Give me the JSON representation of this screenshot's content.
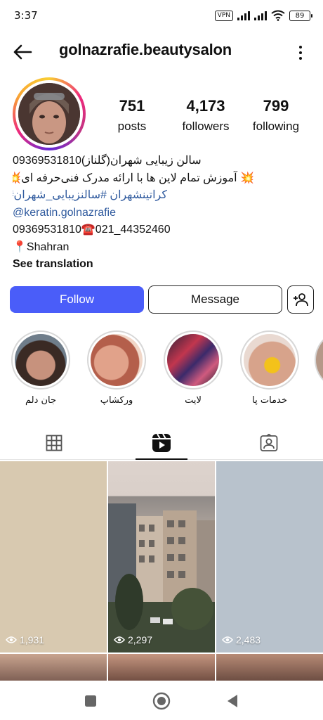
{
  "status": {
    "time": "3:37",
    "vpn": "VPN",
    "battery": "89"
  },
  "header": {
    "username": "golnazrafie.beautysalon"
  },
  "stats": {
    "posts_count": "751",
    "posts_label": "posts",
    "followers_count": "4,173",
    "followers_label": "followers",
    "following_count": "799",
    "following_label": "following"
  },
  "bio": {
    "line1": "سالن زیبایی شهران(گلناز)09369531810",
    "line2": "💥 آموزش تمام لاین ها با ارائه مدرک فنی‌حرفه ای💥",
    "line3": "کراتینشهران #سالنزیبایی_شهران#",
    "line4": "@keratin.golnazrafie",
    "line5": "09369531810☎️021_44352460",
    "line6": "📍Shahran",
    "see_translation": "See translation"
  },
  "actions": {
    "follow": "Follow",
    "message": "Message"
  },
  "highlights": [
    {
      "label": "جان دلم"
    },
    {
      "label": "ورکشاپ"
    },
    {
      "label": "لایت"
    },
    {
      "label": "خدمات پا"
    }
  ],
  "grid": {
    "views": [
      "1,931",
      "2,297",
      "2,483"
    ]
  },
  "colors": {
    "follow_button": "#4a5df9",
    "link_blue": "#2f5a9e"
  },
  "icons": {
    "back": "arrow-left-icon",
    "more": "more-vertical-icon",
    "add_user": "add-user-icon",
    "grid": "grid-icon",
    "reels": "reels-icon",
    "tagged": "tagged-icon",
    "eye": "eye-icon"
  }
}
